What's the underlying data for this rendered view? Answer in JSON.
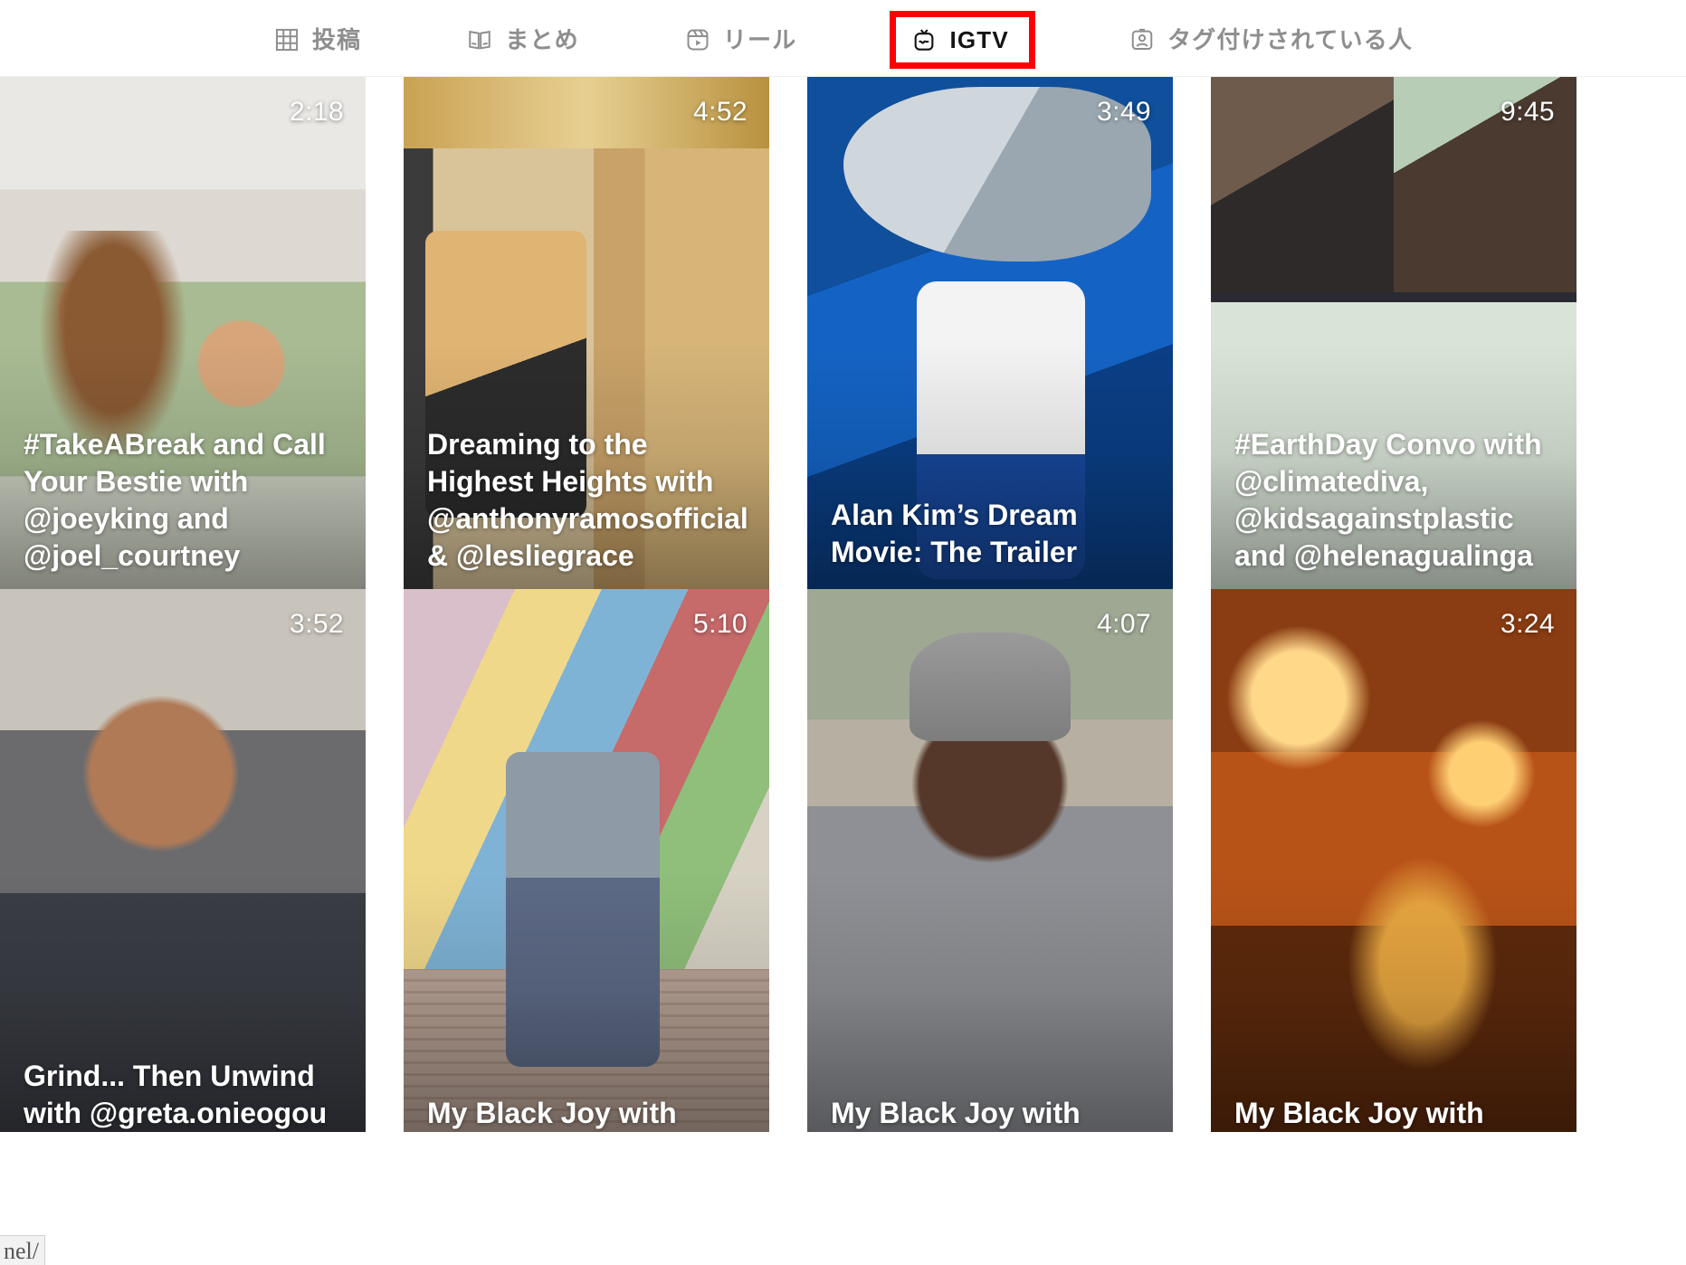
{
  "tabs": [
    {
      "id": "posts",
      "label": "投稿",
      "icon": "grid-icon",
      "active": false,
      "highlighted": false
    },
    {
      "id": "guides",
      "label": "まとめ",
      "icon": "book-icon",
      "active": false,
      "highlighted": false
    },
    {
      "id": "reels",
      "label": "リール",
      "icon": "reels-icon",
      "active": false,
      "highlighted": false
    },
    {
      "id": "igtv",
      "label": "IGTV",
      "icon": "igtv-icon",
      "active": true,
      "highlighted": true
    },
    {
      "id": "tagged",
      "label": "タグ付けされている人",
      "icon": "tagged-person-icon",
      "active": false,
      "highlighted": false
    }
  ],
  "highlight_color": "#ff0000",
  "active_tab_color": "#141414",
  "inactive_tab_color": "#8e8e8e",
  "corner_chip": {
    "text": "nel/"
  },
  "videos": [
    {
      "duration": "2:18",
      "caption": "#TakeABreak and Call Your Bestie with @joeyking and @joel_courtney",
      "art": "a1"
    },
    {
      "duration": "4:52",
      "caption": "Dreaming to the Highest Heights with @anthonyramosofficial & @lesliegrace",
      "art": "a2"
    },
    {
      "duration": "3:49",
      "caption": "Alan Kim’s Dream Movie: The Trailer",
      "art": "a3"
    },
    {
      "duration": "9:45",
      "caption": "#EarthDay Convo with @climatediva, @kidsagainstplastic and @helenagualinga",
      "art": "a4"
    },
    {
      "duration": "3:52",
      "caption": "Grind... Then Unwind with @greta.onieogou",
      "art": "a5"
    },
    {
      "duration": "5:10",
      "caption": "My Black Joy with",
      "art": "a6"
    },
    {
      "duration": "4:07",
      "caption": "My Black Joy with",
      "art": "a7"
    },
    {
      "duration": "3:24",
      "caption": "My Black Joy with",
      "art": "a8"
    }
  ]
}
